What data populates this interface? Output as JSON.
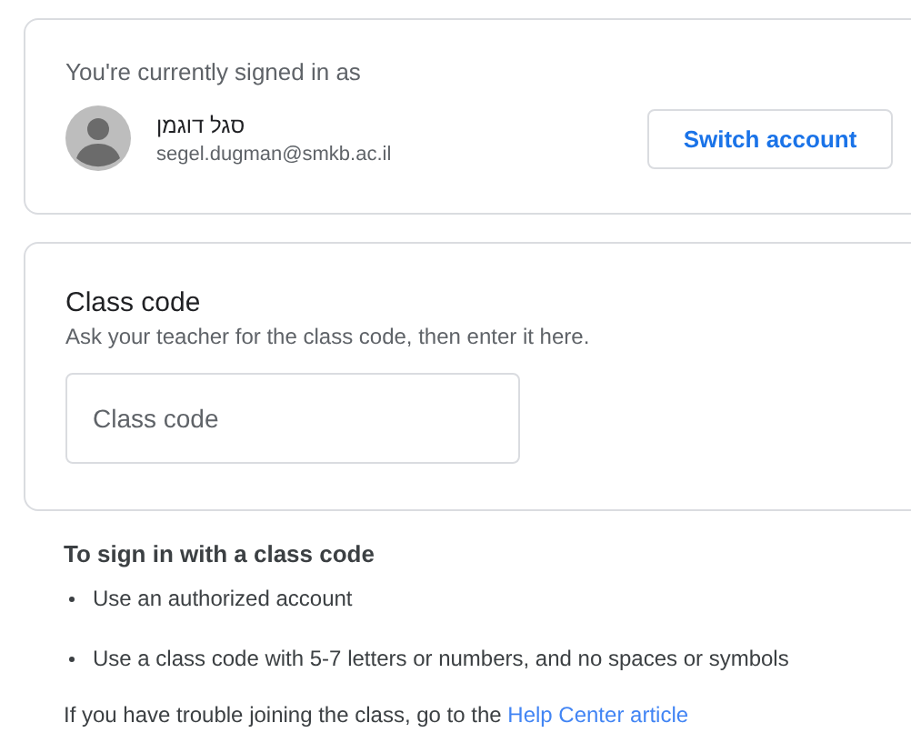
{
  "account_card": {
    "heading": "You're currently signed in as",
    "name": "סגל דוגמן",
    "email": "segel.dugman@smkb.ac.il",
    "switch_button": "Switch account"
  },
  "class_code_card": {
    "title": "Class code",
    "subtitle": "Ask your teacher for the class code, then enter it here.",
    "field": {
      "placeholder": "Class code"
    }
  },
  "help": {
    "heading": "To sign in with a class code",
    "bullets": [
      "Use an authorized account",
      "Use a class code with 5-7 letters or numbers, and no spaces or symbols"
    ],
    "footer": "If you have trouble joining the class, go to the",
    "link": "Help Center article"
  }
}
